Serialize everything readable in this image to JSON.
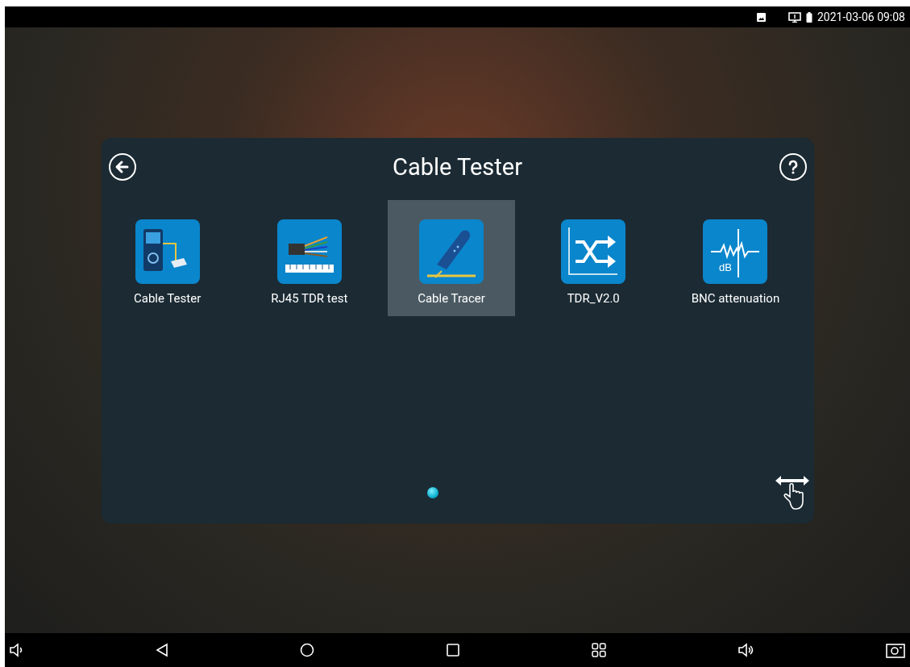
{
  "status_bar": {
    "time": "2021-03-06 09:08"
  },
  "dialog": {
    "title": "Cable Tester",
    "apps": [
      {
        "label": "Cable Tester",
        "kind": "tester",
        "selected": false
      },
      {
        "label": "RJ45 TDR test",
        "kind": "rj45",
        "selected": false
      },
      {
        "label": "Cable Tracer",
        "kind": "tracer",
        "selected": true
      },
      {
        "label": "TDR_V2.0",
        "kind": "tdr",
        "selected": false
      },
      {
        "label": "BNC attenuation",
        "kind": "bnc",
        "icon_text": "dB",
        "selected": false
      }
    ],
    "pages": [
      {
        "selected": true
      }
    ]
  }
}
